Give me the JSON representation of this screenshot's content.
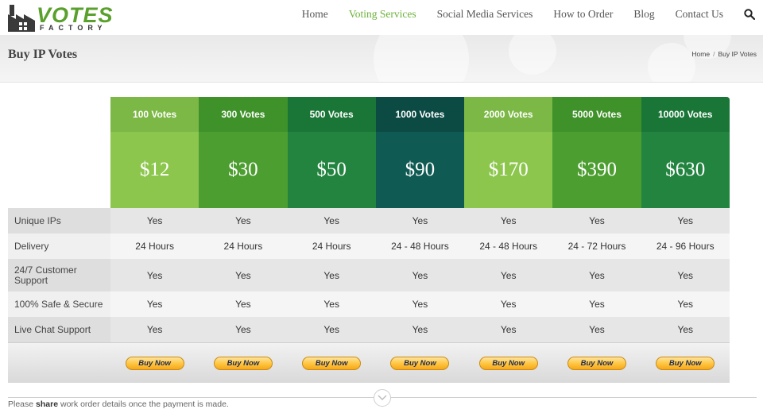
{
  "brand": {
    "name": "VOTES",
    "sub": "FACTORY"
  },
  "nav": {
    "items": [
      {
        "label": "Home",
        "active": false
      },
      {
        "label": "Voting Services",
        "active": true
      },
      {
        "label": "Social Media Services",
        "active": false
      },
      {
        "label": "How to Order",
        "active": false
      },
      {
        "label": "Blog",
        "active": false
      },
      {
        "label": "Contact Us",
        "active": false
      }
    ],
    "search_icon": "search-icon"
  },
  "banner": {
    "title": "Buy IP Votes",
    "breadcrumb": [
      "Home",
      "Buy IP Votes"
    ]
  },
  "pricing": {
    "plans": [
      {
        "name": "100 Votes",
        "price": "$12",
        "color": "#8cc64d"
      },
      {
        "name": "300 Votes",
        "price": "$30",
        "color": "#4d9e31"
      },
      {
        "name": "500 Votes",
        "price": "$50",
        "color": "#22843f"
      },
      {
        "name": "1000 Votes",
        "price": "$90",
        "color": "#0f5a52"
      },
      {
        "name": "2000 Votes",
        "price": "$170",
        "color": "#8cc64d"
      },
      {
        "name": "5000 Votes",
        "price": "$390",
        "color": "#4d9e31"
      },
      {
        "name": "10000 Votes",
        "price": "$630",
        "color": "#22843f"
      }
    ],
    "features": [
      {
        "label": "Unique IPs",
        "values": [
          "Yes",
          "Yes",
          "Yes",
          "Yes",
          "Yes",
          "Yes",
          "Yes"
        ]
      },
      {
        "label": "Delivery",
        "values": [
          "24 Hours",
          "24 Hours",
          "24 Hours",
          "24 - 48 Hours",
          "24 - 48 Hours",
          "24 - 72 Hours",
          "24 - 96 Hours"
        ]
      },
      {
        "label": "24/7 Customer Support",
        "values": [
          "Yes",
          "Yes",
          "Yes",
          "Yes",
          "Yes",
          "Yes",
          "Yes"
        ]
      },
      {
        "label": "100% Safe & Secure",
        "values": [
          "Yes",
          "Yes",
          "Yes",
          "Yes",
          "Yes",
          "Yes",
          "Yes"
        ]
      },
      {
        "label": "Live Chat Support",
        "values": [
          "Yes",
          "Yes",
          "Yes",
          "Yes",
          "Yes",
          "Yes",
          "Yes"
        ]
      }
    ],
    "buy_label": "Buy Now"
  },
  "note": {
    "before": "Please",
    "bold": "share",
    "after": "work order details once the payment is made."
  }
}
